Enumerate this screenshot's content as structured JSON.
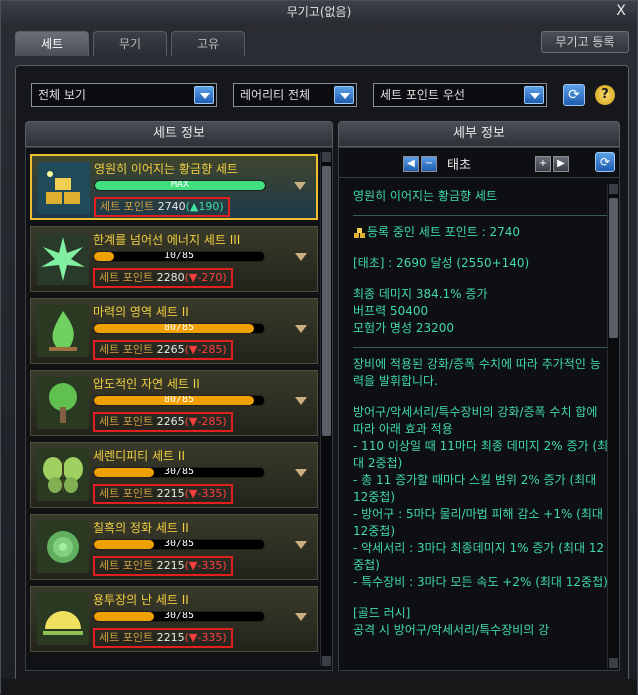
{
  "window": {
    "title": "무기고(없음)",
    "close": "X"
  },
  "tabs": [
    {
      "label": "세트",
      "active": true
    },
    {
      "label": "무기",
      "active": false
    },
    {
      "label": "고유",
      "active": false
    }
  ],
  "register_button": "무기고 등록",
  "filters": {
    "view": "전체 보기",
    "rarity": "레어리티 전체",
    "sort": "세트 포인트 우선"
  },
  "help": "?",
  "refresh": "⟳",
  "set_info_header": "세트 정보",
  "detail_header": "세부 정보",
  "sets": [
    {
      "name": "영원히 이어지는 황금향 세트",
      "progress_text": "MAX",
      "progress": 1.0,
      "points_label": "세트 포인트",
      "points": "2740",
      "delta": "(▲190)",
      "direction": "up",
      "selected": true,
      "icon": "gold-bars-icon",
      "bar_color": "#40e080"
    },
    {
      "name": "한계를 넘어선 에너지 세트 III",
      "progress_text": "10/85",
      "progress": 0.118,
      "points_label": "세트 포인트",
      "points": "2280",
      "delta": "(▼-270)",
      "direction": "down",
      "selected": false,
      "icon": "energy-burst-icon",
      "bar_color": "#f0a000"
    },
    {
      "name": "마력의 영역 세트 II",
      "progress_text": "80/85",
      "progress": 0.941,
      "points_label": "세트 포인트",
      "points": "2265",
      "delta": "(▼-285)",
      "direction": "down",
      "selected": false,
      "icon": "flame-icon",
      "bar_color": "#f0a000"
    },
    {
      "name": "압도적인 자연 세트 II",
      "progress_text": "80/85",
      "progress": 0.941,
      "points_label": "세트 포인트",
      "points": "2265",
      "delta": "(▼-285)",
      "direction": "down",
      "selected": false,
      "icon": "tree-icon",
      "bar_color": "#f0a000"
    },
    {
      "name": "세렌디피티 세트 II",
      "progress_text": "30/85",
      "progress": 0.353,
      "points_label": "세트 포인트",
      "points": "2215",
      "delta": "(▼-335)",
      "direction": "down",
      "selected": false,
      "icon": "butterfly-icon",
      "bar_color": "#f0a000"
    },
    {
      "name": "칠흑의 정화 세트 II",
      "progress_text": "30/85",
      "progress": 0.353,
      "points_label": "세트 포인트",
      "points": "2215",
      "delta": "(▼-335)",
      "direction": "down",
      "selected": false,
      "icon": "rose-icon",
      "bar_color": "#f0a000"
    },
    {
      "name": "용투장의 난 세트 II",
      "progress_text": "30/85",
      "progress": 0.353,
      "points_label": "세트 포인트",
      "points": "2215",
      "delta": "(▼-335)",
      "direction": "down",
      "selected": false,
      "icon": "sunrise-icon",
      "bar_color": "#f0a000"
    }
  ],
  "detail": {
    "title": "태초",
    "prev": "◀",
    "minus": "−",
    "plus": "+",
    "next": "▶",
    "set_name": "영원히 이어지는 황금향 세트",
    "registered_points": "등록 중인 세트 포인트 : 2740",
    "achievement": "[태초] : 2690 달성 (2550+140)",
    "stat1": "최종 데미지 384.1% 증가",
    "stat2": "버프력 50400",
    "stat3": "모험가 명성 23200",
    "desc1": "장비에 적용된 강화/증폭 수치에 따라 추가적인 능력을 발휘합니다.",
    "desc2": "방어구/악세서리/특수장비의 강화/증폭 수치 합에 따라 아래 효과 적용",
    "desc3": "- 110 이상일 때 11마다 최종 데미지 2% 증가 (최대 2중첩)",
    "desc4": "- 총 11 증가할 때마다 스킬 범위 2% 증가 (최대 12중첩)",
    "desc5": "- 방어구 : 5마다 물리/마법 피해 감소 +1% (최대 12중첩)",
    "desc6": "- 악세서리 : 3마다 최종데미지 1% 증가 (최대 12중첩)",
    "desc7": "- 특수장비 : 3마다 모든 속도 +2% (최대 12중첩)",
    "gold_rush": "[골드 러시]",
    "gold_rush_desc": "공격 시 방어구/악세서리/특수장비의 강"
  },
  "colors": {
    "accent_gold": "#f0c030",
    "point_up": "#40e0a0",
    "point_down": "#ff4040",
    "detail_text": "#40d8b0"
  }
}
